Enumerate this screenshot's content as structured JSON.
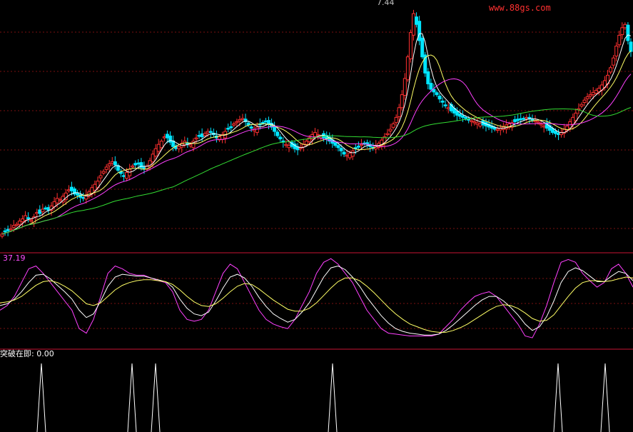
{
  "watermark": "www.88gs.com",
  "price_panel": {
    "peak_label": "7.44"
  },
  "oscillator_panel": {
    "label": "37.19"
  },
  "signal_panel": {
    "label": "突破在即: 0.00"
  },
  "colors": {
    "up": "#ff3030",
    "down": "#00e5ff",
    "ma_fast": "#ffffff",
    "ma_mid": "#ffff66",
    "ma_slow": "#ff40ff",
    "ma_long": "#33dd33",
    "divider": "#a0102a",
    "grid": "#7a1010",
    "signal": "#ffffff"
  },
  "chart_data": [
    {
      "type": "candlestick",
      "title": "",
      "ylim": [
        3.0,
        7.6
      ],
      "grid": true,
      "series": [
        {
          "name": "",
          "role": "close",
          "values": [
            3.32,
            3.36,
            3.38,
            3.42,
            3.48,
            3.5,
            3.56,
            3.6,
            3.66,
            3.62,
            3.58,
            3.64,
            3.72,
            3.7,
            3.78,
            3.8,
            3.76,
            3.84,
            3.92,
            3.98,
            3.96,
            4.02,
            4.08,
            4.14,
            4.12,
            4.06,
            4.04,
            4.0,
            3.98,
            4.04,
            4.1,
            4.18,
            4.24,
            4.3,
            4.4,
            4.48,
            4.56,
            4.62,
            4.66,
            4.6,
            4.5,
            4.44,
            4.4,
            4.46,
            4.52,
            4.58,
            4.6,
            4.62,
            4.55,
            4.52,
            4.58,
            4.68,
            4.8,
            4.9,
            4.98,
            5.04,
            5.12,
            5.1,
            5.02,
            4.94,
            4.9,
            4.94,
            5.0,
            5.04,
            5.0,
            4.98,
            5.04,
            5.1,
            5.14,
            5.12,
            5.18,
            5.22,
            5.2,
            5.16,
            5.1,
            5.12,
            5.16,
            5.22,
            5.26,
            5.3,
            5.36,
            5.4,
            5.44,
            5.46,
            5.4,
            5.34,
            5.28,
            5.26,
            5.3,
            5.34,
            5.38,
            5.4,
            5.36,
            5.3,
            5.22,
            5.14,
            5.08,
            5.02,
            4.98,
            4.96,
            4.94,
            4.9,
            4.88,
            4.92,
            4.98,
            5.04,
            5.1,
            5.16,
            5.2,
            5.16,
            5.12,
            5.1,
            5.08,
            5.04,
            5.0,
            4.96,
            4.92,
            4.86,
            4.8,
            4.78,
            4.82,
            4.86,
            4.9,
            4.94,
            4.98,
            5.0,
            4.98,
            4.94,
            4.92,
            4.96,
            5.0,
            5.06,
            5.12,
            5.18,
            5.26,
            5.36,
            5.48,
            5.66,
            5.9,
            6.2,
            6.6,
            7.05,
            7.4,
            7.2,
            6.9,
            6.6,
            6.3,
            6.1,
            6.0,
            5.95,
            5.9,
            5.82,
            5.76,
            5.7,
            5.66,
            5.6,
            5.56,
            5.52,
            5.5,
            5.48,
            5.46,
            5.44,
            5.42,
            5.4,
            5.38,
            5.36,
            5.34,
            5.32,
            5.3,
            5.28,
            5.26,
            5.26,
            5.28,
            5.3,
            5.34,
            5.36,
            5.38,
            5.4,
            5.42,
            5.44,
            5.46,
            5.48,
            5.46,
            5.44,
            5.42,
            5.4,
            5.36,
            5.32,
            5.28,
            5.24,
            5.2,
            5.18,
            5.16,
            5.2,
            5.26,
            5.32,
            5.4,
            5.48,
            5.56,
            5.64,
            5.72,
            5.8,
            5.86,
            5.9,
            5.94,
            5.98,
            6.02,
            6.08,
            6.16,
            6.26,
            6.4,
            6.58,
            6.8,
            7.0,
            7.14,
            7.2,
            6.9,
            6.7
          ]
        }
      ]
    },
    {
      "type": "line",
      "title": "",
      "ylim": [
        0,
        100
      ],
      "series": [
        {
          "name": "",
          "values": [
            40,
            45,
            55,
            70,
            85,
            88,
            80,
            70,
            60,
            50,
            40,
            20,
            15,
            30,
            55,
            80,
            88,
            85,
            80,
            78,
            78,
            75,
            72,
            70,
            60,
            40,
            30,
            28,
            30,
            40,
            60,
            80,
            90,
            85,
            70,
            55,
            40,
            30,
            25,
            22,
            20,
            30,
            45,
            60,
            80,
            92,
            96,
            90,
            80,
            70,
            55,
            40,
            30,
            20,
            15,
            14,
            13,
            12,
            12,
            12,
            12,
            14,
            22,
            30,
            40,
            48,
            55,
            58,
            60,
            55,
            45,
            35,
            25,
            12,
            10,
            25,
            45,
            70,
            92,
            95,
            92,
            80,
            72,
            65,
            70,
            85,
            90,
            80,
            65
          ]
        },
        {
          "name": "",
          "values": [
            45,
            47,
            52,
            60,
            70,
            78,
            79,
            74,
            67,
            60,
            52,
            40,
            32,
            36,
            50,
            66,
            76,
            79,
            78,
            77,
            77,
            75,
            73,
            71,
            65,
            52,
            42,
            36,
            34,
            38,
            50,
            64,
            76,
            79,
            75,
            66,
            54,
            44,
            36,
            31,
            27,
            30,
            38,
            48,
            62,
            76,
            86,
            88,
            84,
            76,
            66,
            54,
            44,
            34,
            26,
            20,
            17,
            15,
            14,
            13,
            13,
            14,
            18,
            24,
            31,
            38,
            45,
            51,
            55,
            55,
            50,
            43,
            35,
            25,
            18,
            22,
            33,
            50,
            70,
            82,
            86,
            83,
            77,
            71,
            71,
            77,
            82,
            80,
            72
          ]
        },
        {
          "name": "",
          "values": [
            48,
            49,
            51,
            55,
            61,
            67,
            71,
            72,
            70,
            66,
            61,
            54,
            47,
            45,
            48,
            55,
            62,
            67,
            70,
            72,
            73,
            73,
            72,
            71,
            68,
            62,
            55,
            49,
            45,
            44,
            47,
            53,
            60,
            66,
            69,
            68,
            63,
            57,
            51,
            46,
            41,
            39,
            39,
            42,
            48,
            56,
            64,
            71,
            75,
            75,
            72,
            66,
            59,
            51,
            43,
            36,
            30,
            25,
            22,
            19,
            17,
            16,
            16,
            18,
            21,
            25,
            30,
            35,
            40,
            44,
            46,
            45,
            42,
            37,
            31,
            28,
            29,
            35,
            45,
            55,
            64,
            70,
            72,
            72,
            71,
            72,
            74,
            76,
            75
          ]
        }
      ]
    },
    {
      "type": "line",
      "title": "",
      "ylim": [
        0,
        1
      ],
      "series": [
        {
          "name": "突破在即",
          "signal_bars": [
            58,
            185,
            218,
            466,
            782,
            848
          ]
        }
      ]
    }
  ]
}
